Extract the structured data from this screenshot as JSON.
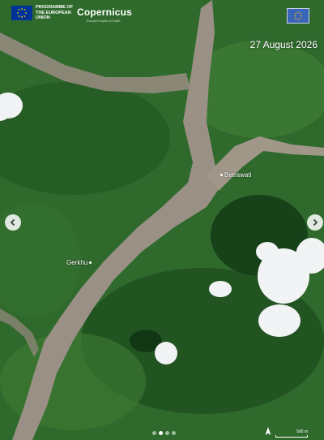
{
  "branding": {
    "eu_text": "PROGRAMME OF THE EUROPEAN UNION",
    "copernicus_text": "Copernicus",
    "copernicus_sub": "Europe's eyes on Earth"
  },
  "date": "27 August 2026",
  "places": {
    "betrawati": "Betrawati",
    "gerkhu": "Gerkhu"
  },
  "scale": {
    "label": "500 m"
  },
  "pager": {
    "count": 4,
    "active_index": 1
  },
  "colors": {
    "forest_dark": "#1c4a1e",
    "forest_light": "#3c7a34",
    "river_sediment": "#9a9085",
    "cloud": "#f2f3f4",
    "eu_blue": "#003399"
  },
  "icons": {
    "prev": "chevron-left-icon",
    "next": "chevron-right-icon",
    "north": "north-arrow-icon",
    "flag": "eu-flag-icon"
  }
}
